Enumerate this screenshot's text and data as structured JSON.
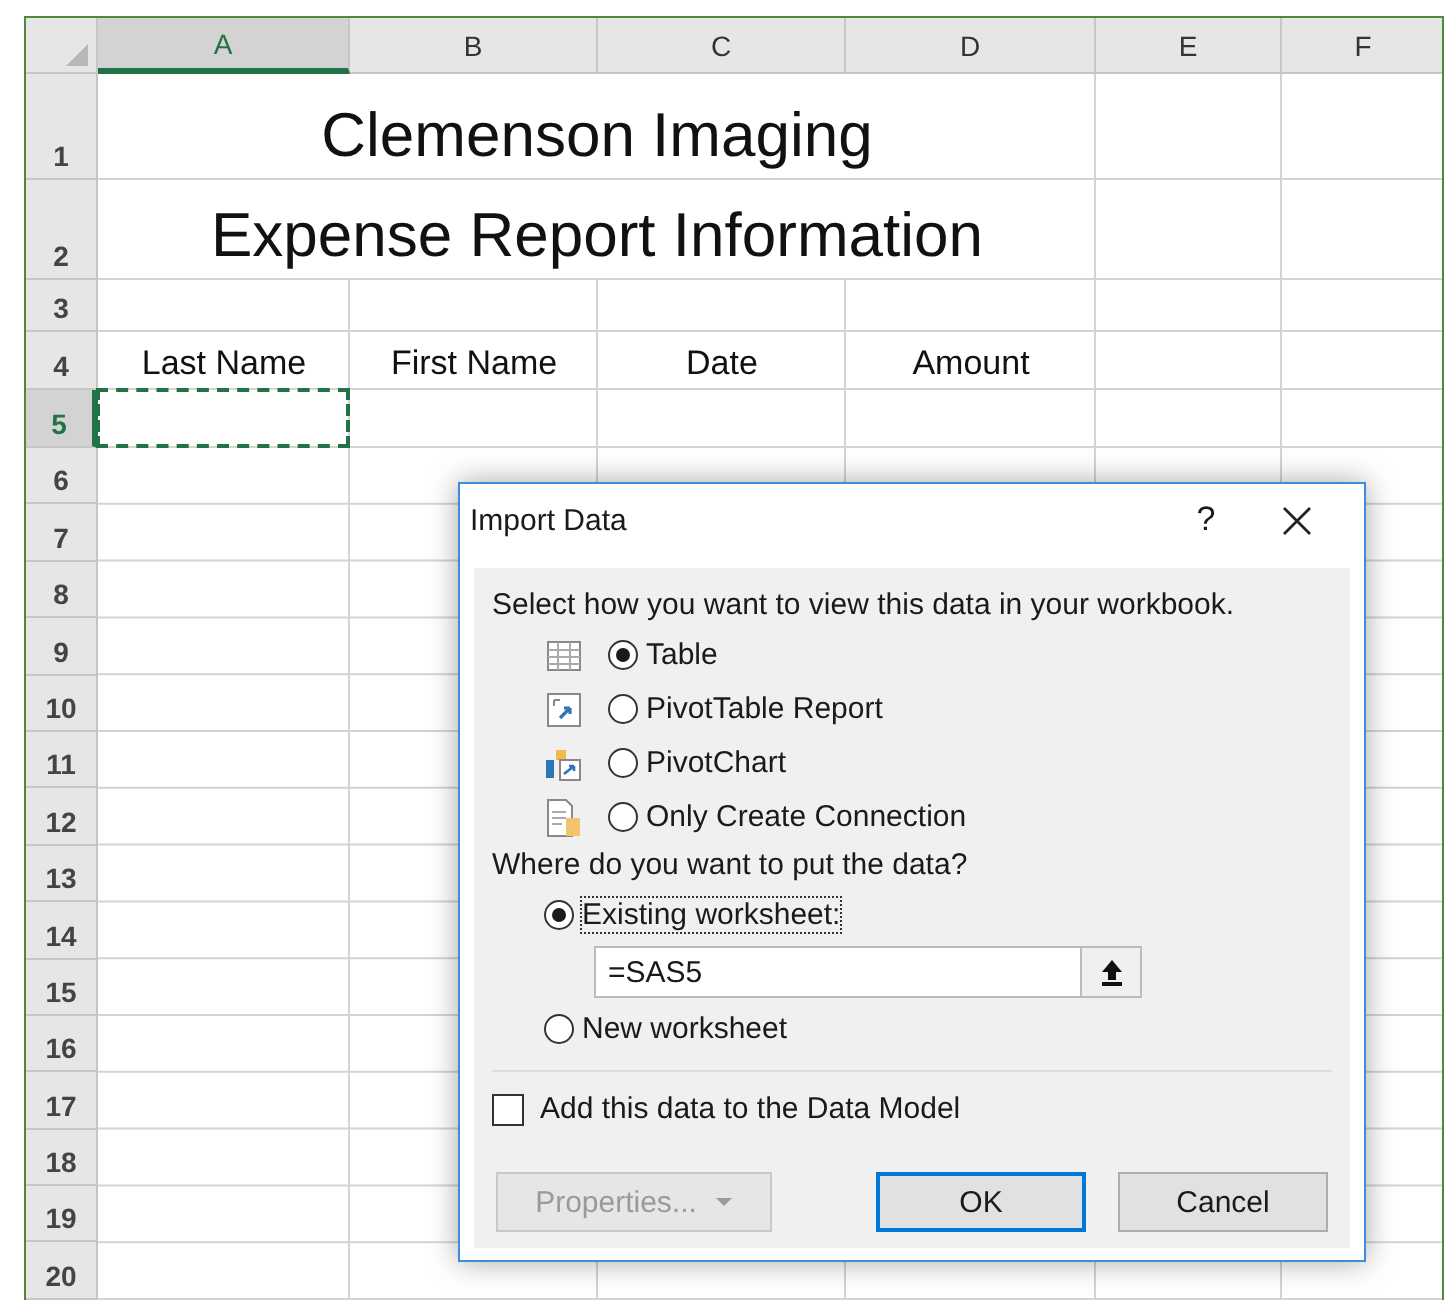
{
  "sheet": {
    "columns": [
      {
        "label": "A",
        "selected": true
      },
      {
        "label": "B",
        "selected": false
      },
      {
        "label": "C",
        "selected": false
      },
      {
        "label": "D",
        "selected": false
      },
      {
        "label": "E",
        "selected": false
      },
      {
        "label": "F",
        "selected": false
      }
    ],
    "rows": [
      {
        "label": "1",
        "selected": false
      },
      {
        "label": "2",
        "selected": false
      },
      {
        "label": "3",
        "selected": false
      },
      {
        "label": "4",
        "selected": false
      },
      {
        "label": "5",
        "selected": true
      },
      {
        "label": "6",
        "selected": false
      },
      {
        "label": "7",
        "selected": false
      },
      {
        "label": "8",
        "selected": false
      },
      {
        "label": "9",
        "selected": false
      },
      {
        "label": "10",
        "selected": false
      },
      {
        "label": "11",
        "selected": false
      },
      {
        "label": "12",
        "selected": false
      },
      {
        "label": "13",
        "selected": false
      },
      {
        "label": "14",
        "selected": false
      },
      {
        "label": "15",
        "selected": false
      },
      {
        "label": "16",
        "selected": false
      },
      {
        "label": "17",
        "selected": false
      },
      {
        "label": "18",
        "selected": false
      },
      {
        "label": "19",
        "selected": false
      },
      {
        "label": "20",
        "selected": false
      }
    ],
    "title_lines": [
      "Clemenson Imaging",
      "Expense Report Information"
    ],
    "header_row": [
      "Last Name",
      "First Name",
      "Date",
      "Amount"
    ]
  },
  "dialog": {
    "title": "Import Data",
    "help": "?",
    "view_prompt": "Select how you want to view this data in your workbook.",
    "view_options": [
      {
        "label": "Table",
        "selected": true,
        "kind": "table"
      },
      {
        "label": "PivotTable Report",
        "selected": false,
        "kind": "pivottable"
      },
      {
        "label": "PivotChart",
        "selected": false,
        "kind": "pivotchart"
      },
      {
        "label": "Only Create Connection",
        "selected": false,
        "kind": "connection"
      }
    ],
    "location_prompt": "Where do you want to put the data?",
    "location_options": [
      {
        "label": "Existing worksheet:",
        "selected": true,
        "focused": true
      },
      {
        "label": "New worksheet",
        "selected": false,
        "focused": false
      }
    ],
    "reference": {
      "value": "=SAS5"
    },
    "data_model": {
      "label": "Add this data to the Data Model",
      "checked": false
    },
    "buttons": [
      {
        "label": "Properties...",
        "disabled": true,
        "dropdown": true,
        "default": false
      },
      {
        "label": "OK",
        "disabled": false,
        "dropdown": false,
        "default": true
      },
      {
        "label": "Cancel",
        "disabled": false,
        "dropdown": false,
        "default": false
      }
    ]
  }
}
